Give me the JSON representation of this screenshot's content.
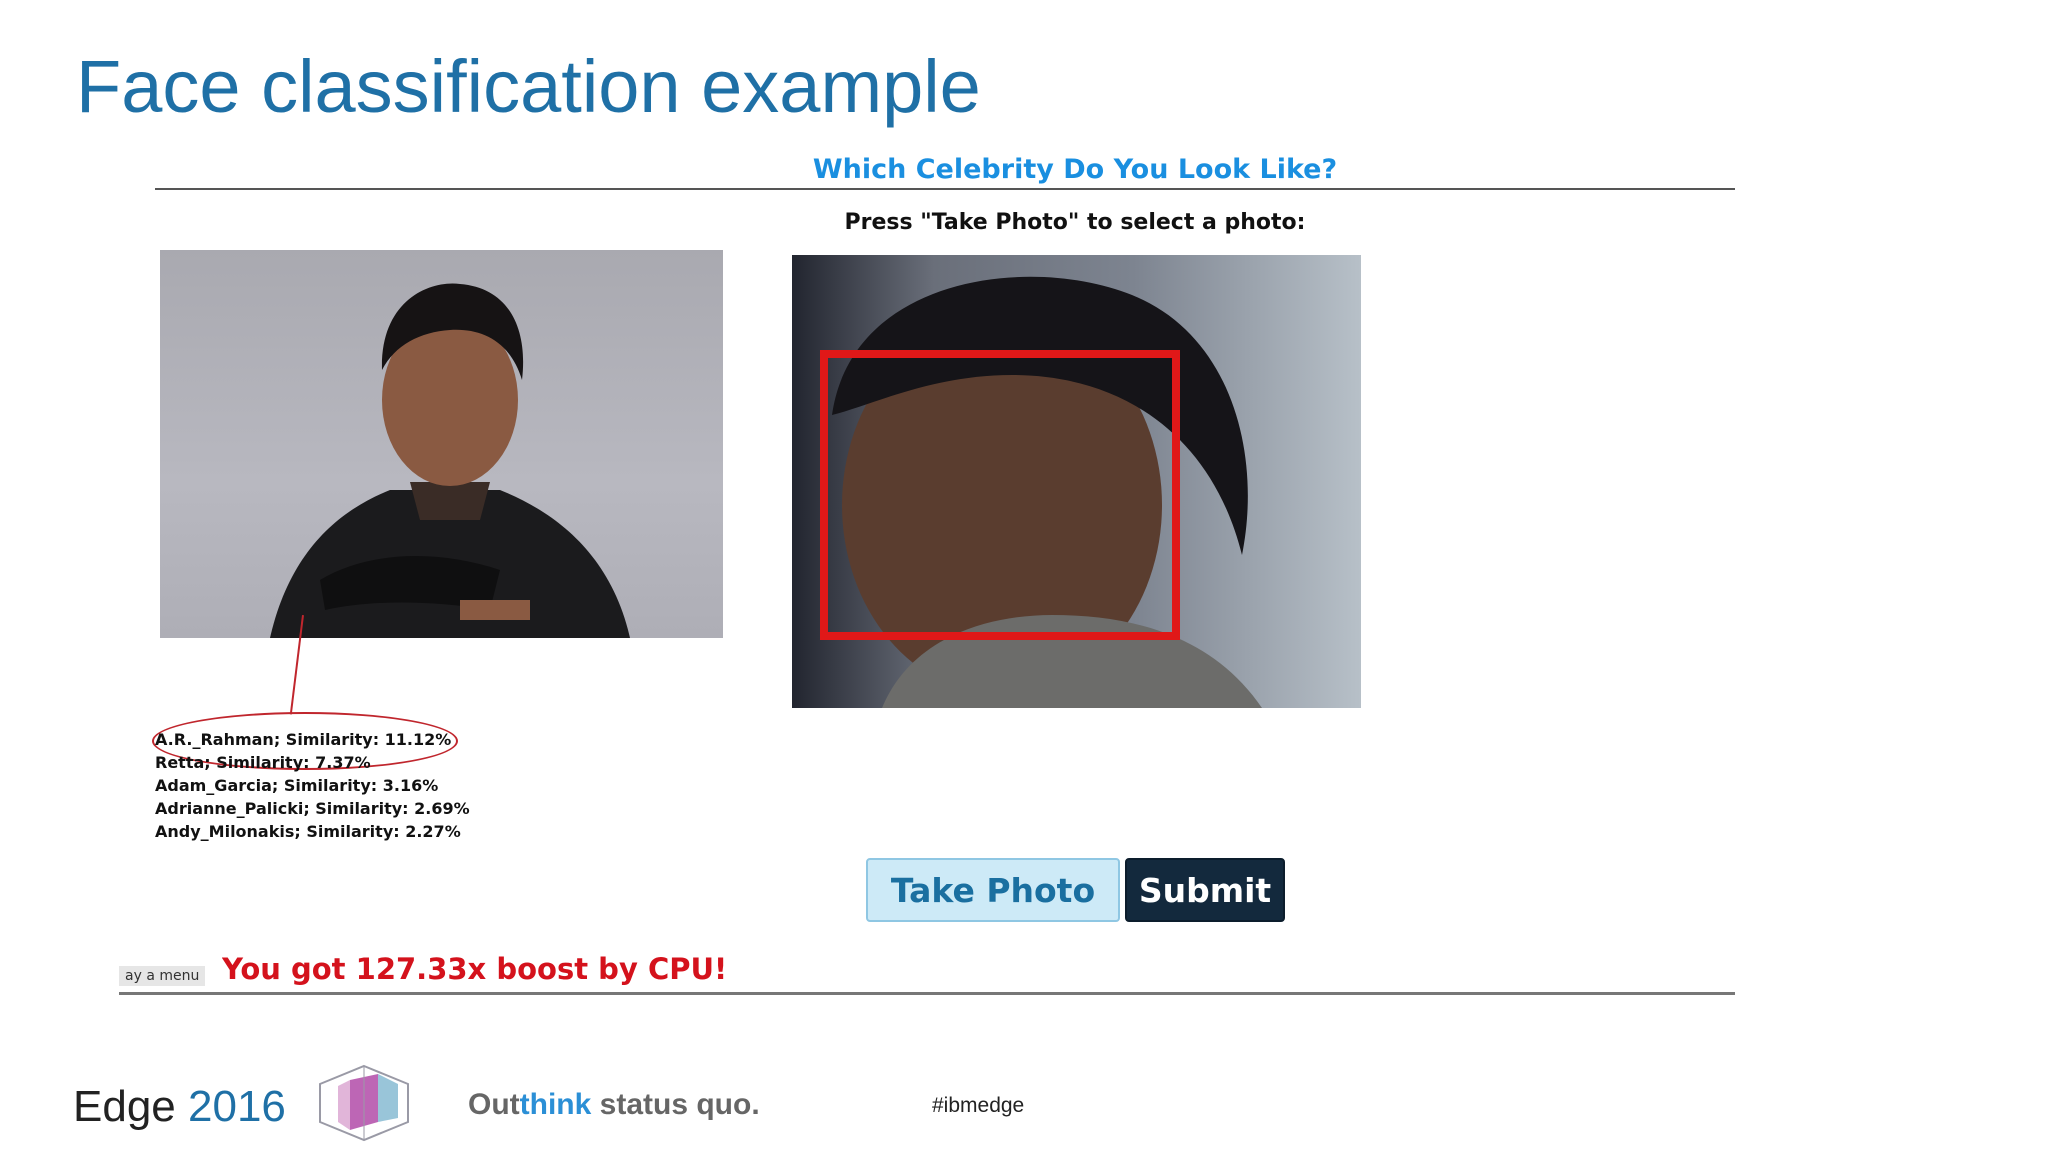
{
  "slide": {
    "title": "Face classification example"
  },
  "app": {
    "heading": "Which Celebrity Do You Look Like?",
    "prompt": "Press \"Take Photo\" to select a photo:",
    "results": [
      "A.R._Rahman; Similarity: 11.12%",
      "Retta; Similarity: 7.37%",
      "Adam_Garcia; Similarity: 3.16%",
      "Adrianne_Palicki; Similarity: 2.69%",
      "Andy_Milonakis; Similarity: 2.27%"
    ],
    "take_photo_label": "Take Photo",
    "submit_label": "Submit",
    "menu_tab_label": "ay a menu",
    "boost_text": "You got 127.33x boost by CPU!",
    "colors": {
      "heading": "#1a8fe0",
      "face_box": "#e01818",
      "callout": "#c0262d",
      "boost": "#d4121c"
    }
  },
  "footer": {
    "brand": "Edge",
    "year": "2016",
    "tagline_prefix": "Out",
    "tagline_accent": "think",
    "tagline_suffix": " status quo.",
    "hashtag": "#ibmedge"
  }
}
